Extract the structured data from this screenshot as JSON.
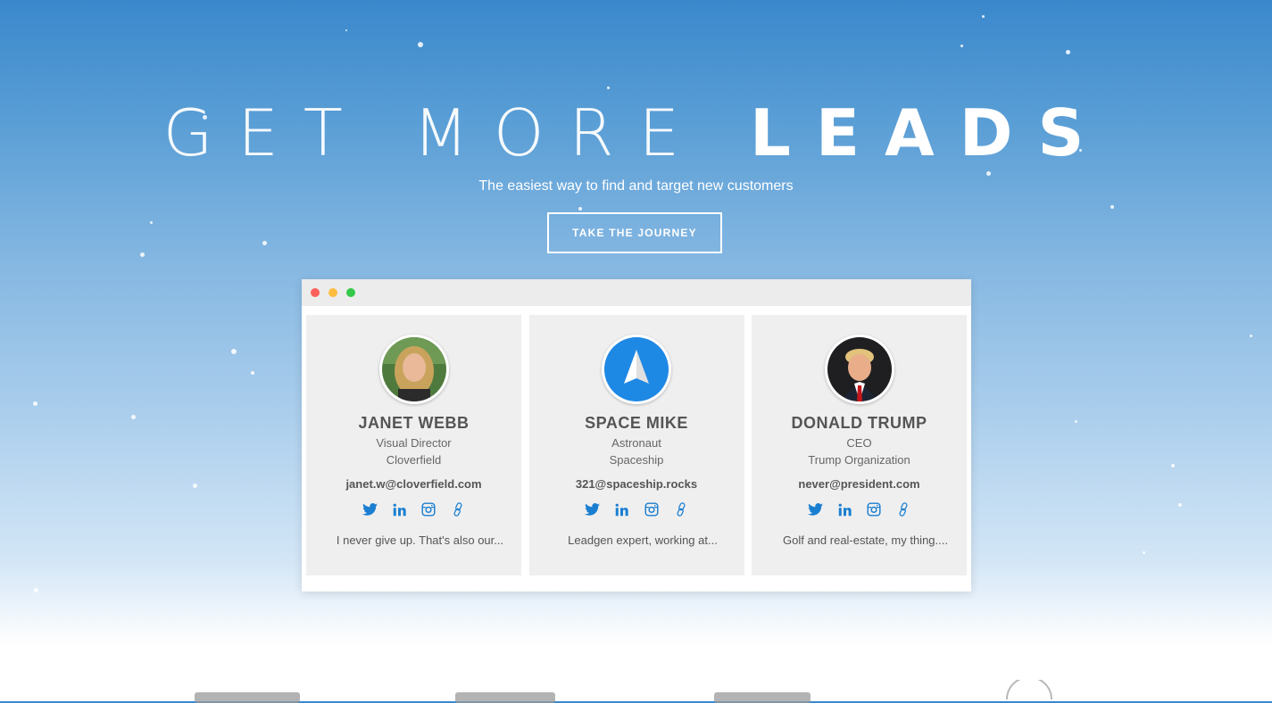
{
  "hero": {
    "title_light": "GET MORE",
    "title_bold": "LEADS",
    "subtitle": "The easiest way to find and target new customers",
    "cta_label": "TAKE THE JOURNEY"
  },
  "window": {
    "controls": [
      "close",
      "minimize",
      "maximize"
    ]
  },
  "cards": [
    {
      "name": "JANET WEBB",
      "role": "Visual Director",
      "company": "Cloverfield",
      "email": "janet.w@cloverfield.com",
      "bio": "I never give up. That's also our...",
      "socials": [
        "twitter-icon",
        "linkedin-icon",
        "instagram-icon",
        "link-icon"
      ]
    },
    {
      "name": "SPACE MIKE",
      "role": "Astronaut",
      "company": "Spaceship",
      "email": "321@spaceship.rocks",
      "bio": "Leadgen expert, working at...",
      "socials": [
        "twitter-icon",
        "linkedin-icon",
        "instagram-icon",
        "link-icon"
      ]
    },
    {
      "name": "DONALD TRUMP",
      "role": "CEO",
      "company": "Trump Organization",
      "email": "never@president.com",
      "bio": "Golf and real-estate, my thing....",
      "socials": [
        "twitter-icon",
        "linkedin-icon",
        "instagram-icon",
        "link-icon"
      ]
    }
  ],
  "colors": {
    "accent": "#1b7fd1",
    "sky_top": "#3a88cc",
    "card_bg": "#efefef"
  }
}
